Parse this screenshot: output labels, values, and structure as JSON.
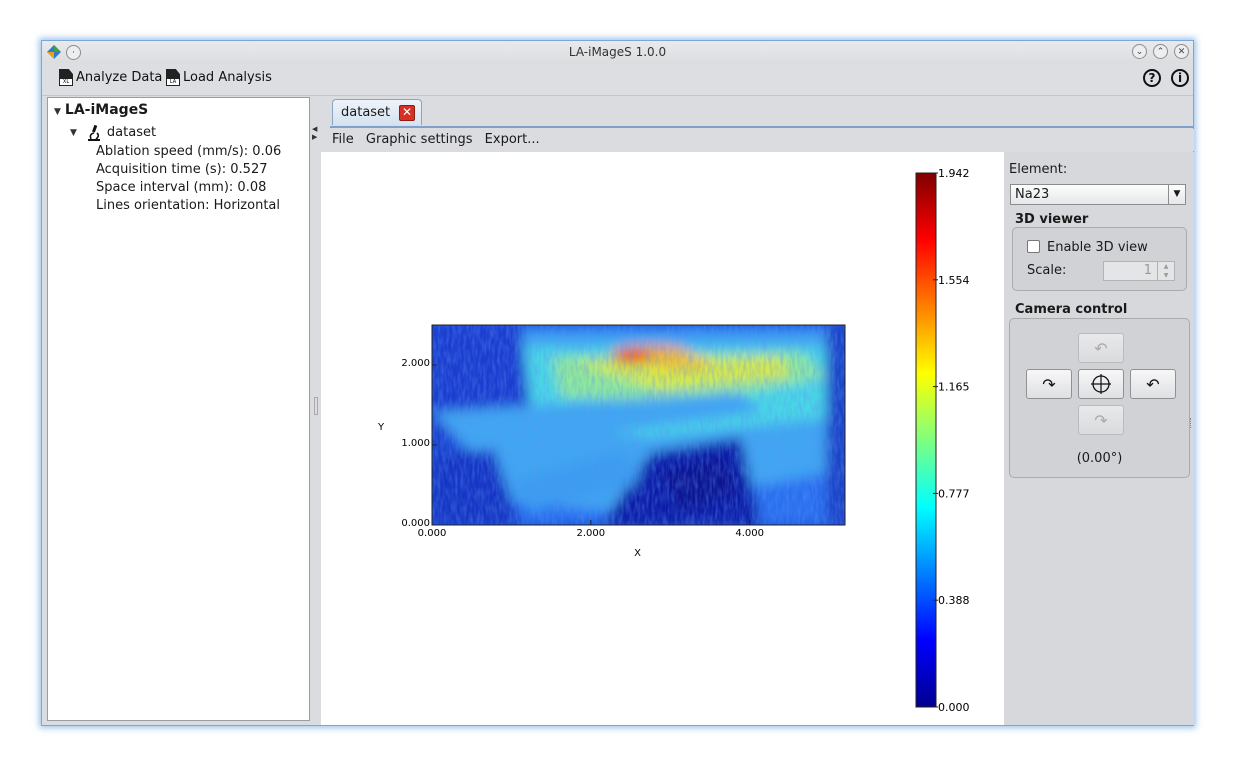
{
  "window": {
    "title": "LA-iMageS 1.0.0"
  },
  "toolbar": {
    "analyze_label": "Analyze Data",
    "analyze_badge": "XL",
    "load_label": "Load Analysis",
    "load_badge": "LA",
    "help_glyph": "?",
    "info_glyph": "i"
  },
  "tree": {
    "root": "LA-iMageS",
    "dataset": "dataset",
    "properties": [
      "Ablation speed (mm/s): 0.06",
      "Acquisition time (s): 0.527",
      "Space interval (mm): 0.08",
      "Lines orientation: Horizontal"
    ]
  },
  "tabs": [
    {
      "label": "dataset"
    }
  ],
  "menu": {
    "file": "File",
    "graphic": "Graphic settings",
    "export": "Export..."
  },
  "side": {
    "element_label": "Element:",
    "element_value": "Na23",
    "viewer_title": "3D viewer",
    "enable_label": "Enable 3D view",
    "enable_checked": false,
    "scale_label": "Scale:",
    "scale_value": "1",
    "camera_title": "Camera control",
    "angle": "(0.00°)"
  },
  "chart_data": {
    "type": "heatmap",
    "xlabel": "X",
    "ylabel": "Y",
    "x_ticks": [
      "0.000",
      "2.000",
      "4.000"
    ],
    "y_ticks": [
      "0.000",
      "1.000",
      "2.000"
    ],
    "xlim": [
      0,
      5.2
    ],
    "ylim": [
      0,
      2.5
    ],
    "colorbar": {
      "colormap": "jet",
      "ticks": [
        "1.942",
        "1.554",
        "1.165",
        "0.777",
        "0.388",
        "0.000"
      ],
      "min": 0.0,
      "max": 1.942
    }
  },
  "icons": {
    "app": "app-logo-icon",
    "pin": "pin-icon",
    "minimize": "minimize-icon",
    "maximize": "maximize-icon",
    "close": "close-icon",
    "microscope": "microscope-icon"
  }
}
